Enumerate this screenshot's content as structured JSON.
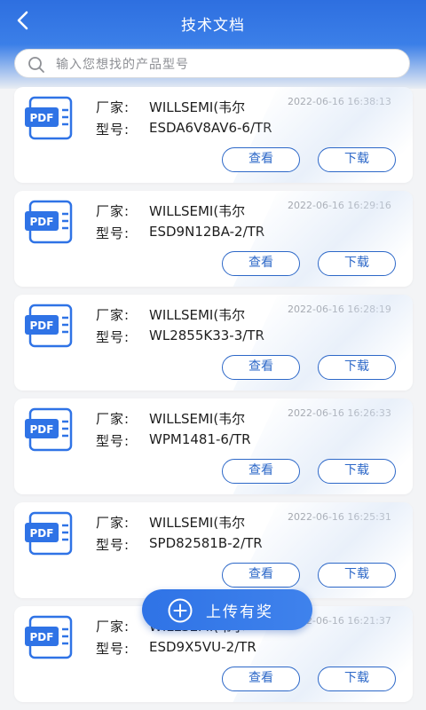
{
  "header": {
    "title": "技术文档"
  },
  "search": {
    "placeholder": "输入您想找的产品型号"
  },
  "labels": {
    "manufacturer": "厂家:",
    "model": "型号:",
    "view": "查看",
    "download": "下载",
    "pdf": "PDF"
  },
  "documents": [
    {
      "manufacturer": "WILLSEMI(韦尔",
      "model": "ESDA6V8AV6-6/TR",
      "time": "2022-06-16 16:38:13"
    },
    {
      "manufacturer": "WILLSEMI(韦尔",
      "model": "ESD9N12BA-2/TR",
      "time": "2022-06-16 16:29:16"
    },
    {
      "manufacturer": "WILLSEMI(韦尔",
      "model": "WL2855K33-3/TR",
      "time": "2022-06-16 16:28:19"
    },
    {
      "manufacturer": "WILLSEMI(韦尔",
      "model": "WPM1481-6/TR",
      "time": "2022-06-16 16:26:33"
    },
    {
      "manufacturer": "WILLSEMI(韦尔",
      "model": "SPD82581B-2/TR",
      "time": "2022-06-16 16:25:31"
    },
    {
      "manufacturer": "WILLSEMI(韦尔",
      "model": "ESD9X5VU-2/TR",
      "time": "2022-06-16 16:21:37"
    }
  ],
  "fab": {
    "label": "上传有奖"
  },
  "colors": {
    "primary": "#2f73e6",
    "button_border": "#2d68c8",
    "background": "#f3f4f6"
  }
}
